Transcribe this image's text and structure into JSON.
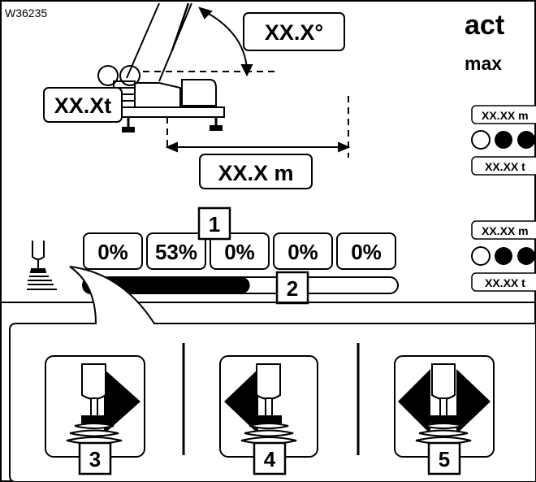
{
  "figure_id": "W36235",
  "top": {
    "angle_label": "XX.X°",
    "load_label": "XX.Xt",
    "radius_label": "XX.X m",
    "act_label": "act",
    "max_label": "max",
    "act_panel": {
      "top_value": "XX.XX m",
      "bottom_value": "XX.XX t"
    },
    "max_panel": {
      "top_value": "XX.XX m",
      "bottom_value": "XX.XX t"
    }
  },
  "load_indicators": {
    "values": [
      "0%",
      "53%",
      "0%",
      "0%",
      "0%"
    ],
    "bar_fill_percent": 53
  },
  "callouts": {
    "callout_1": "1",
    "callout_2": "2",
    "callout_3": "3",
    "callout_4": "4",
    "callout_5": "5"
  },
  "icons": [
    "crane-icon",
    "joystick-icon",
    "joystick-right-icon",
    "joystick-left-icon",
    "joystick-both-icon"
  ]
}
